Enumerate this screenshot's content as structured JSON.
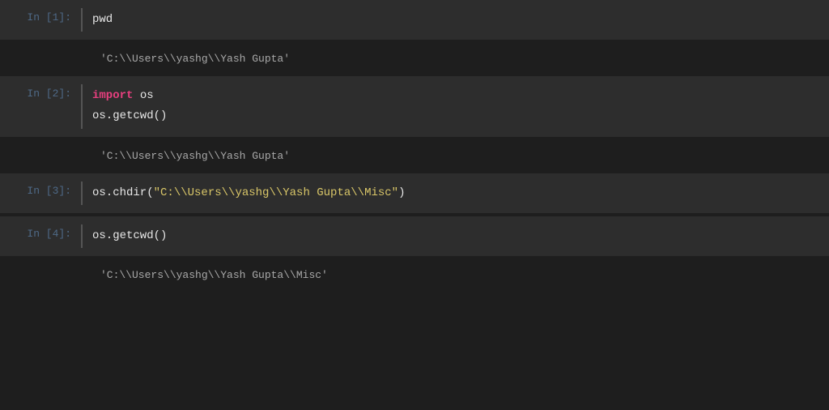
{
  "cells": [
    {
      "prompt": "In [1]:",
      "input": {
        "lines": [
          {
            "plain": "pwd"
          }
        ]
      },
      "output": "'C:\\\\Users\\\\yashg\\\\Yash Gupta'"
    },
    {
      "prompt": "In [2]:",
      "input": {
        "line1_keyword": "import",
        "line1_module": " os",
        "line2": "os.getcwd()"
      },
      "output": "'C:\\\\Users\\\\yashg\\\\Yash Gupta'"
    },
    {
      "prompt": "In [3]:",
      "input": {
        "prefix": "os.chdir(",
        "string": "\"C:\\\\Users\\\\yashg\\\\Yash Gupta\\\\Misc\"",
        "suffix": ")"
      },
      "output": null
    },
    {
      "prompt": "In [4]:",
      "input": {
        "line1": "os.getcwd()"
      },
      "output": "'C:\\\\Users\\\\yashg\\\\Yash Gupta\\\\Misc'"
    }
  ]
}
